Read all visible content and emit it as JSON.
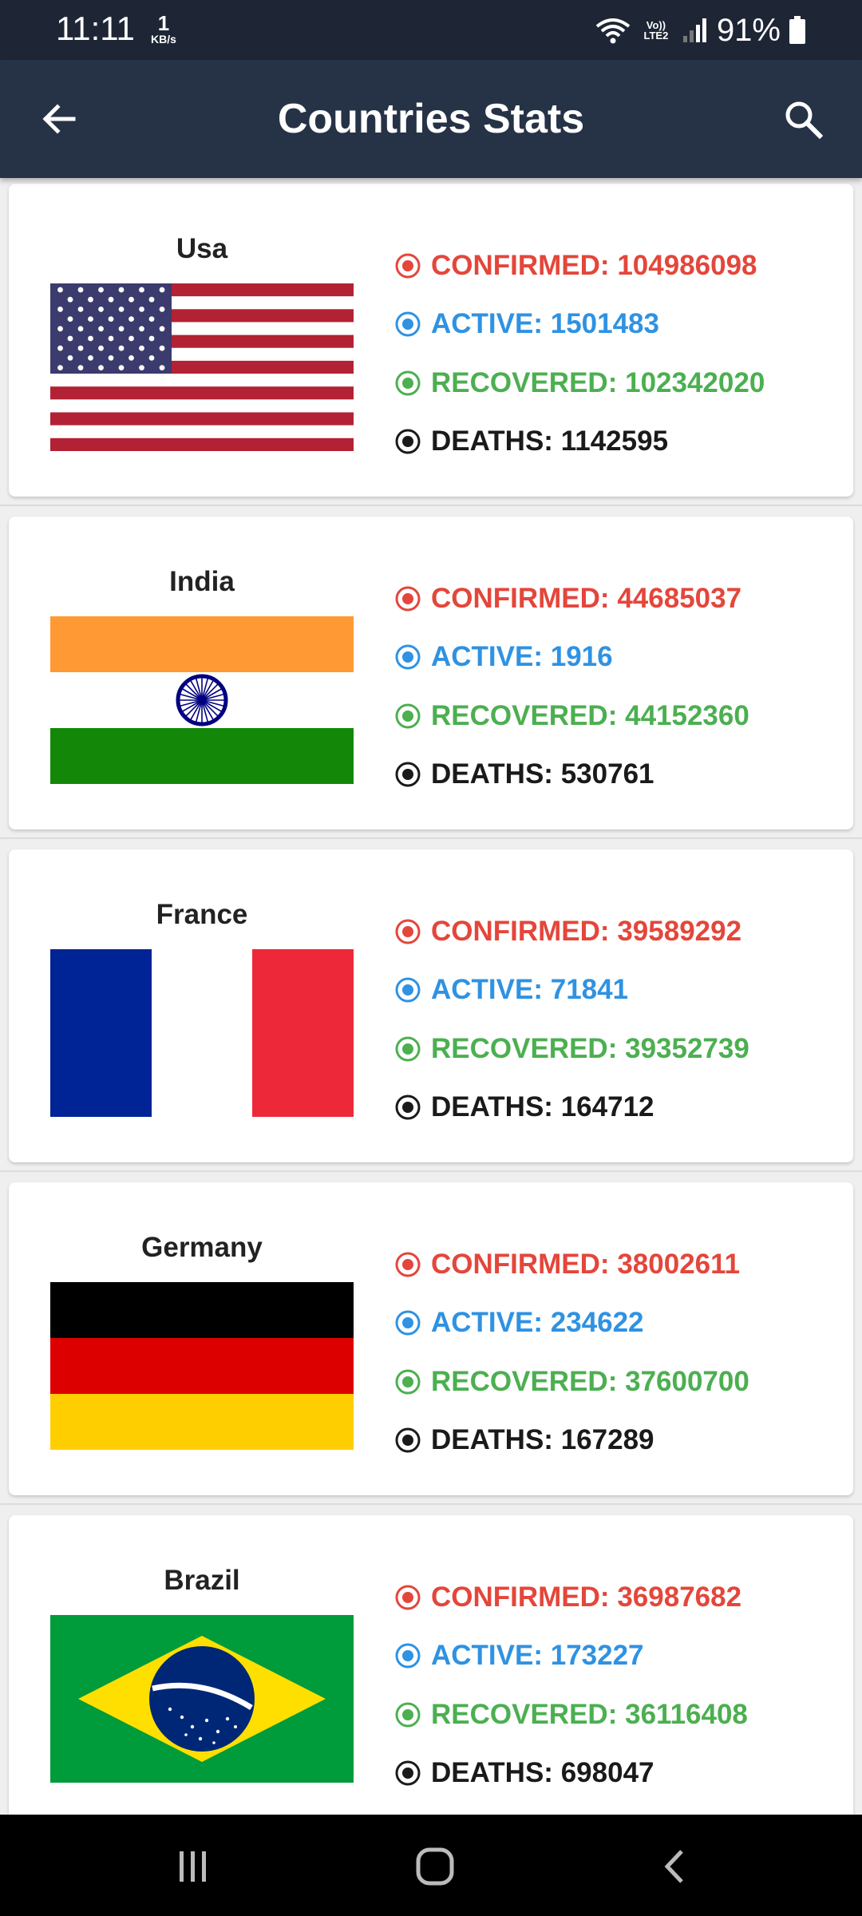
{
  "status_bar": {
    "time": "11:11",
    "speed_value": "1",
    "speed_unit": "KB/s",
    "network_label": "Vo)) LTE2",
    "battery": "91%"
  },
  "app_bar": {
    "title": "Countries Stats",
    "back_icon": "arrow-left-icon",
    "search_icon": "search-icon"
  },
  "labels": {
    "confirmed": "CONFIRMED:",
    "active": "ACTIVE:",
    "recovered": "RECOVERED:",
    "deaths": "DEATHS:"
  },
  "colors": {
    "confirmed": "#e4463b",
    "active": "#2f92e2",
    "recovered": "#4caf50",
    "deaths": "#1a1a1a",
    "app_bar": "#263246",
    "status_bar": "#1e2636"
  },
  "countries": [
    {
      "name": "Usa",
      "flag": "usa-flag",
      "confirmed": "104986098",
      "active": "1501483",
      "recovered": "102342020",
      "deaths": "1142595"
    },
    {
      "name": "India",
      "flag": "india-flag",
      "confirmed": "44685037",
      "active": "1916",
      "recovered": "44152360",
      "deaths": "530761"
    },
    {
      "name": "France",
      "flag": "france-flag",
      "confirmed": "39589292",
      "active": "71841",
      "recovered": "39352739",
      "deaths": "164712"
    },
    {
      "name": "Germany",
      "flag": "germany-flag",
      "confirmed": "38002611",
      "active": "234622",
      "recovered": "37600700",
      "deaths": "167289"
    },
    {
      "name": "Brazil",
      "flag": "brazil-flag",
      "confirmed": "36987682",
      "active": "173227",
      "recovered": "36116408",
      "deaths": "698047"
    }
  ],
  "nav_bar": {
    "recents_icon": "recents-icon",
    "home_icon": "home-icon",
    "back_icon": "nav-back-icon"
  }
}
